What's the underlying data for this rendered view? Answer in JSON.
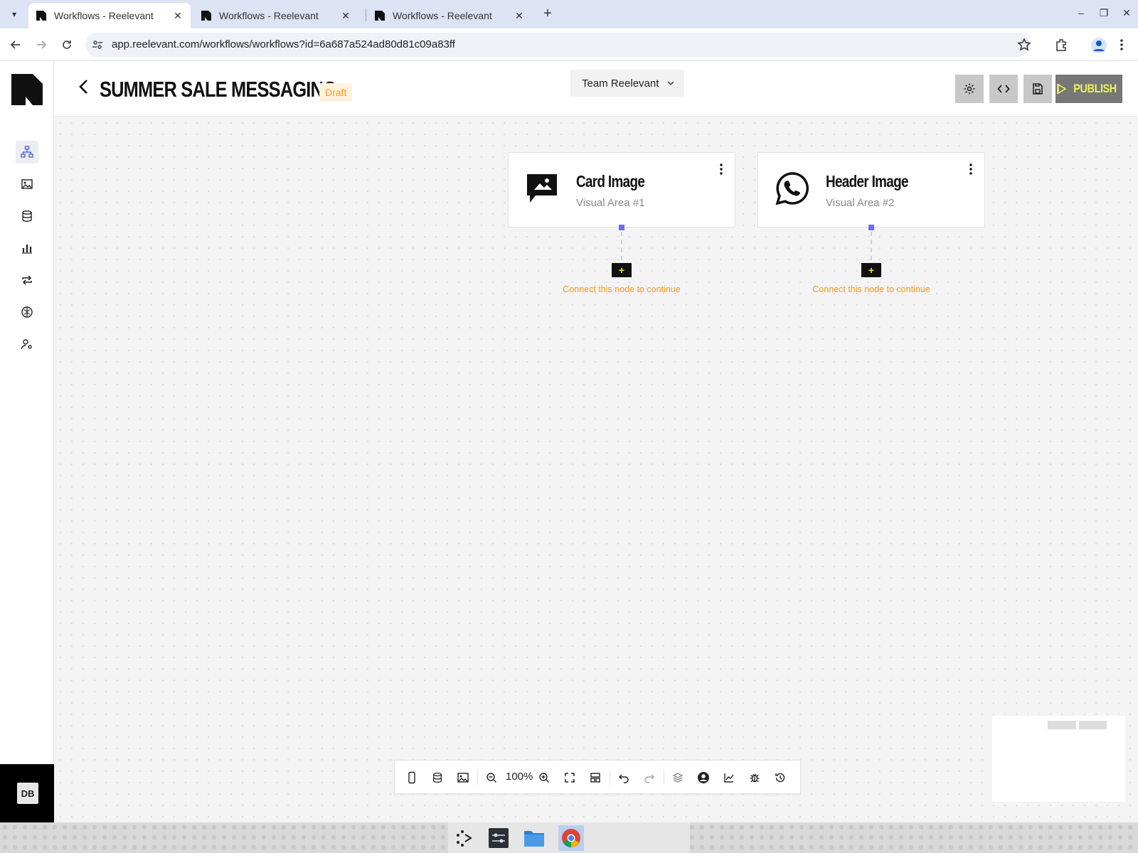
{
  "browser": {
    "tabs": [
      {
        "title": "Workflows - Reelevant",
        "active": true
      },
      {
        "title": "Workflows - Reelevant",
        "active": false
      },
      {
        "title": "Workflows - Reelevant",
        "active": false
      }
    ],
    "url": "app.reelevant.com/workflows/workflows?id=6a687a524ad80d81c09a83ff"
  },
  "header": {
    "title": "SUMMER SALE MESSAGING",
    "status": "Draft",
    "team": "Team Reelevant",
    "publish_label": "PUBLISH"
  },
  "sidebar": {
    "items": [
      {
        "name": "workflows",
        "icon": "workflow-icon",
        "active": true
      },
      {
        "name": "visuals",
        "icon": "visual-icon",
        "active": false
      },
      {
        "name": "data",
        "icon": "database-icon",
        "active": false
      },
      {
        "name": "analytics",
        "icon": "bar-chart-icon",
        "active": false
      },
      {
        "name": "sync",
        "icon": "repeat-icon",
        "active": false
      },
      {
        "name": "ai",
        "icon": "brain-icon",
        "active": false
      },
      {
        "name": "users",
        "icon": "user-settings-icon",
        "active": false
      }
    ],
    "avatar": "DB"
  },
  "nodes": [
    {
      "title": "Card Image",
      "subtitle": "Visual Area #1",
      "icon": "chat-image-icon",
      "hint": "Connect this node to continue"
    },
    {
      "title": "Header Image",
      "subtitle": "Visual Area #2",
      "icon": "whatsapp-icon",
      "hint": "Connect this node to continue"
    }
  ],
  "bottom_toolbar": {
    "zoom": "100%"
  },
  "colors": {
    "accent_yellow": "#e9f55a",
    "draft_orange": "#f39a1e",
    "port_blue": "#6c6cff"
  }
}
